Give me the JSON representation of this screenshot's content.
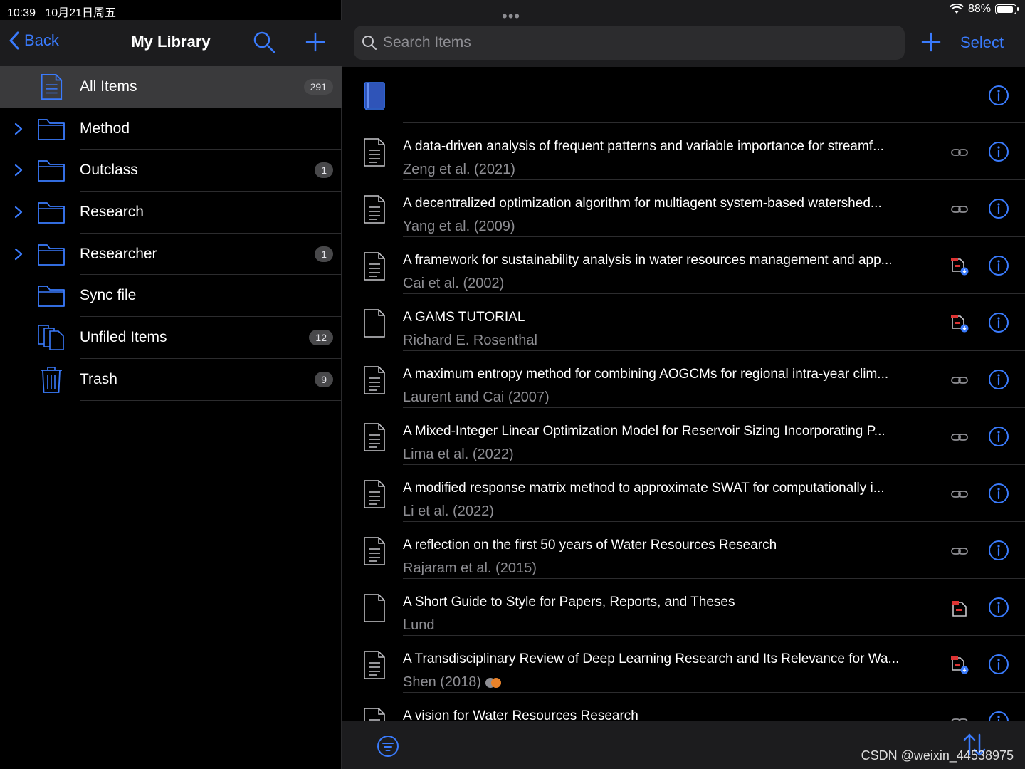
{
  "status": {
    "time": "10:39",
    "date": "10月21日周五",
    "battery": "88%"
  },
  "colors": {
    "accent": "#3a7bfd",
    "background": "#000000",
    "header": "#1c1c1e",
    "selected_row": "#3a3a3c"
  },
  "sidebar": {
    "back_label": "Back",
    "title": "My Library",
    "items": [
      {
        "label": "All Items",
        "icon": "document-icon",
        "count": "291",
        "expandable": false,
        "selected": true
      },
      {
        "label": "Method",
        "icon": "folder-icon",
        "count": "",
        "expandable": true
      },
      {
        "label": "Outclass",
        "icon": "folder-icon",
        "count": "1",
        "expandable": true
      },
      {
        "label": "Research",
        "icon": "folder-icon",
        "count": "",
        "expandable": true
      },
      {
        "label": "Researcher",
        "icon": "folder-icon",
        "count": "1",
        "expandable": true
      },
      {
        "label": "Sync file",
        "icon": "folder-icon",
        "count": "",
        "expandable": false
      },
      {
        "label": "Unfiled Items",
        "icon": "unfiled-icon",
        "count": "12",
        "expandable": false
      },
      {
        "label": "Trash",
        "icon": "trash-icon",
        "count": "9",
        "expandable": false
      }
    ]
  },
  "main": {
    "search_placeholder": "Search Items",
    "select_label": "Select",
    "items": [
      {
        "title": "",
        "subtitle": "",
        "icon": "book-icon",
        "attachment": "none"
      },
      {
        "title": "A data-driven analysis of frequent patterns and variable importance for streamf...",
        "subtitle": "Zeng et al. (2021)",
        "icon": "journal-article-icon",
        "attachment": "link"
      },
      {
        "title": "A decentralized optimization algorithm for multiagent system-based watershed...",
        "subtitle": "Yang et al. (2009)",
        "icon": "journal-article-icon",
        "attachment": "link"
      },
      {
        "title": "A framework for sustainability analysis in water resources management and app...",
        "subtitle": "Cai et al. (2002)",
        "icon": "journal-article-icon",
        "attachment": "pdf-download"
      },
      {
        "title": "A GAMS TUTORIAL",
        "subtitle": "Richard E. Rosenthal",
        "icon": "document-blank-icon",
        "attachment": "pdf-download"
      },
      {
        "title": "A maximum entropy method for combining AOGCMs for regional intra-year clim...",
        "subtitle": "Laurent and Cai (2007)",
        "icon": "journal-article-icon",
        "attachment": "link"
      },
      {
        "title": "A Mixed-Integer Linear Optimization Model for Reservoir Sizing Incorporating P...",
        "subtitle": "Lima et al. (2022)",
        "icon": "journal-article-icon",
        "attachment": "link"
      },
      {
        "title": "A modified response matrix method to approximate SWAT for computationally i...",
        "subtitle": "Li et al. (2022)",
        "icon": "journal-article-icon",
        "attachment": "link"
      },
      {
        "title": "A reflection on the first 50 years of Water Resources Research",
        "subtitle": "Rajaram et al. (2015)",
        "icon": "journal-article-icon",
        "attachment": "link"
      },
      {
        "title": "A Short Guide to Style for Papers, Reports, and Theses",
        "subtitle": "Lund",
        "icon": "document-blank-icon",
        "attachment": "pdf"
      },
      {
        "title": "A Transdisciplinary Review of Deep Learning Research and Its Relevance for Wa...",
        "subtitle": "Shen (2018)",
        "icon": "journal-article-icon",
        "attachment": "pdf-download",
        "tags": [
          "#8e8e93",
          "#e8822a"
        ]
      },
      {
        "title": "A vision for Water Resources Research",
        "subtitle": "",
        "icon": "journal-article-icon",
        "attachment": "link"
      }
    ]
  },
  "watermark": "CSDN @weixin_44538975"
}
